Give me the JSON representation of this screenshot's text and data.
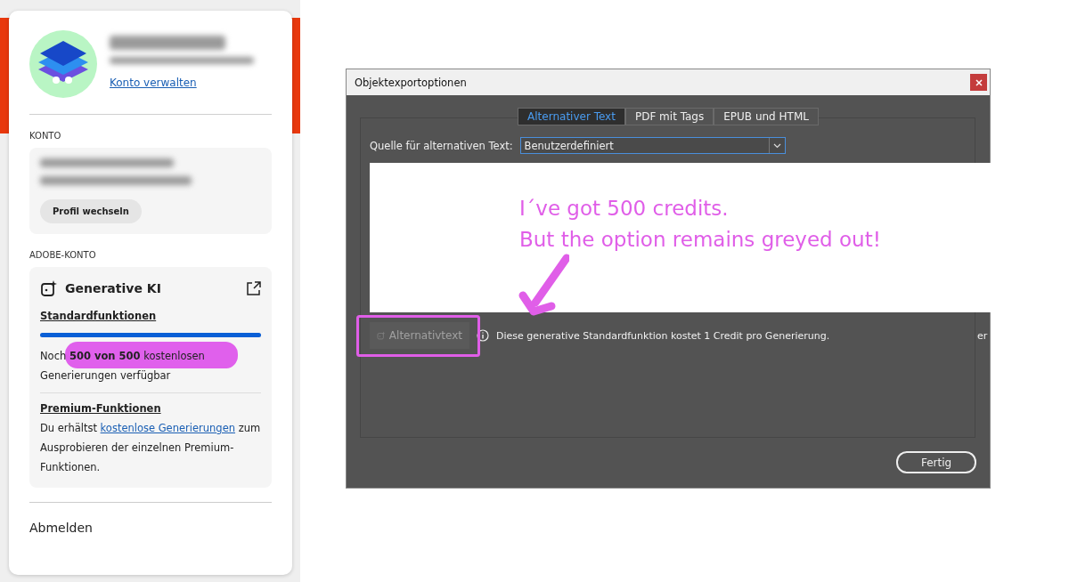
{
  "account_panel": {
    "manage_link": "Konto verwalten",
    "konto": {
      "heading": "KONTO",
      "switch_button": "Profil wechseln"
    },
    "adobe_konto": {
      "heading": "ADOBE-KONTO",
      "card_title": "Generative KI",
      "standard": {
        "heading": "Standardfunktionen",
        "level": 1,
        "text": "Noch **500 von 500** kostenlosen Generierungen verfügbar",
        "highlighted": true
      },
      "premium": {
        "heading": "Premium-Funktionen",
        "text_before": "Du erhältst",
        "link": "kostenlose Generierungen",
        "text_after": "zum Ausprobieren der einzelnen Premium-Funktionen."
      }
    },
    "sign_out": "Abmelden"
  },
  "dialog": {
    "title": "Objektexportoptionen",
    "tabs": [
      {
        "label": "Alternativer Text",
        "selected": true
      },
      {
        "label": "PDF mit Tags",
        "selected": false
      },
      {
        "label": "EPUB und HTML",
        "selected": false
      }
    ],
    "source_label": "Quelle für alternativen Text:",
    "source_value": "Benutzerdefiniert",
    "alt_button": {
      "label": "Alternativtext",
      "disabled": true
    },
    "info": "Diese generative Standardfunktion kostet 1 Credit pro Generierung.",
    "cut_text": "er",
    "done_button": "Fertig"
  },
  "annotation": {
    "lines": [
      "I´ve got 500 credits.",
      "But the option remains greyed out!"
    ]
  }
}
